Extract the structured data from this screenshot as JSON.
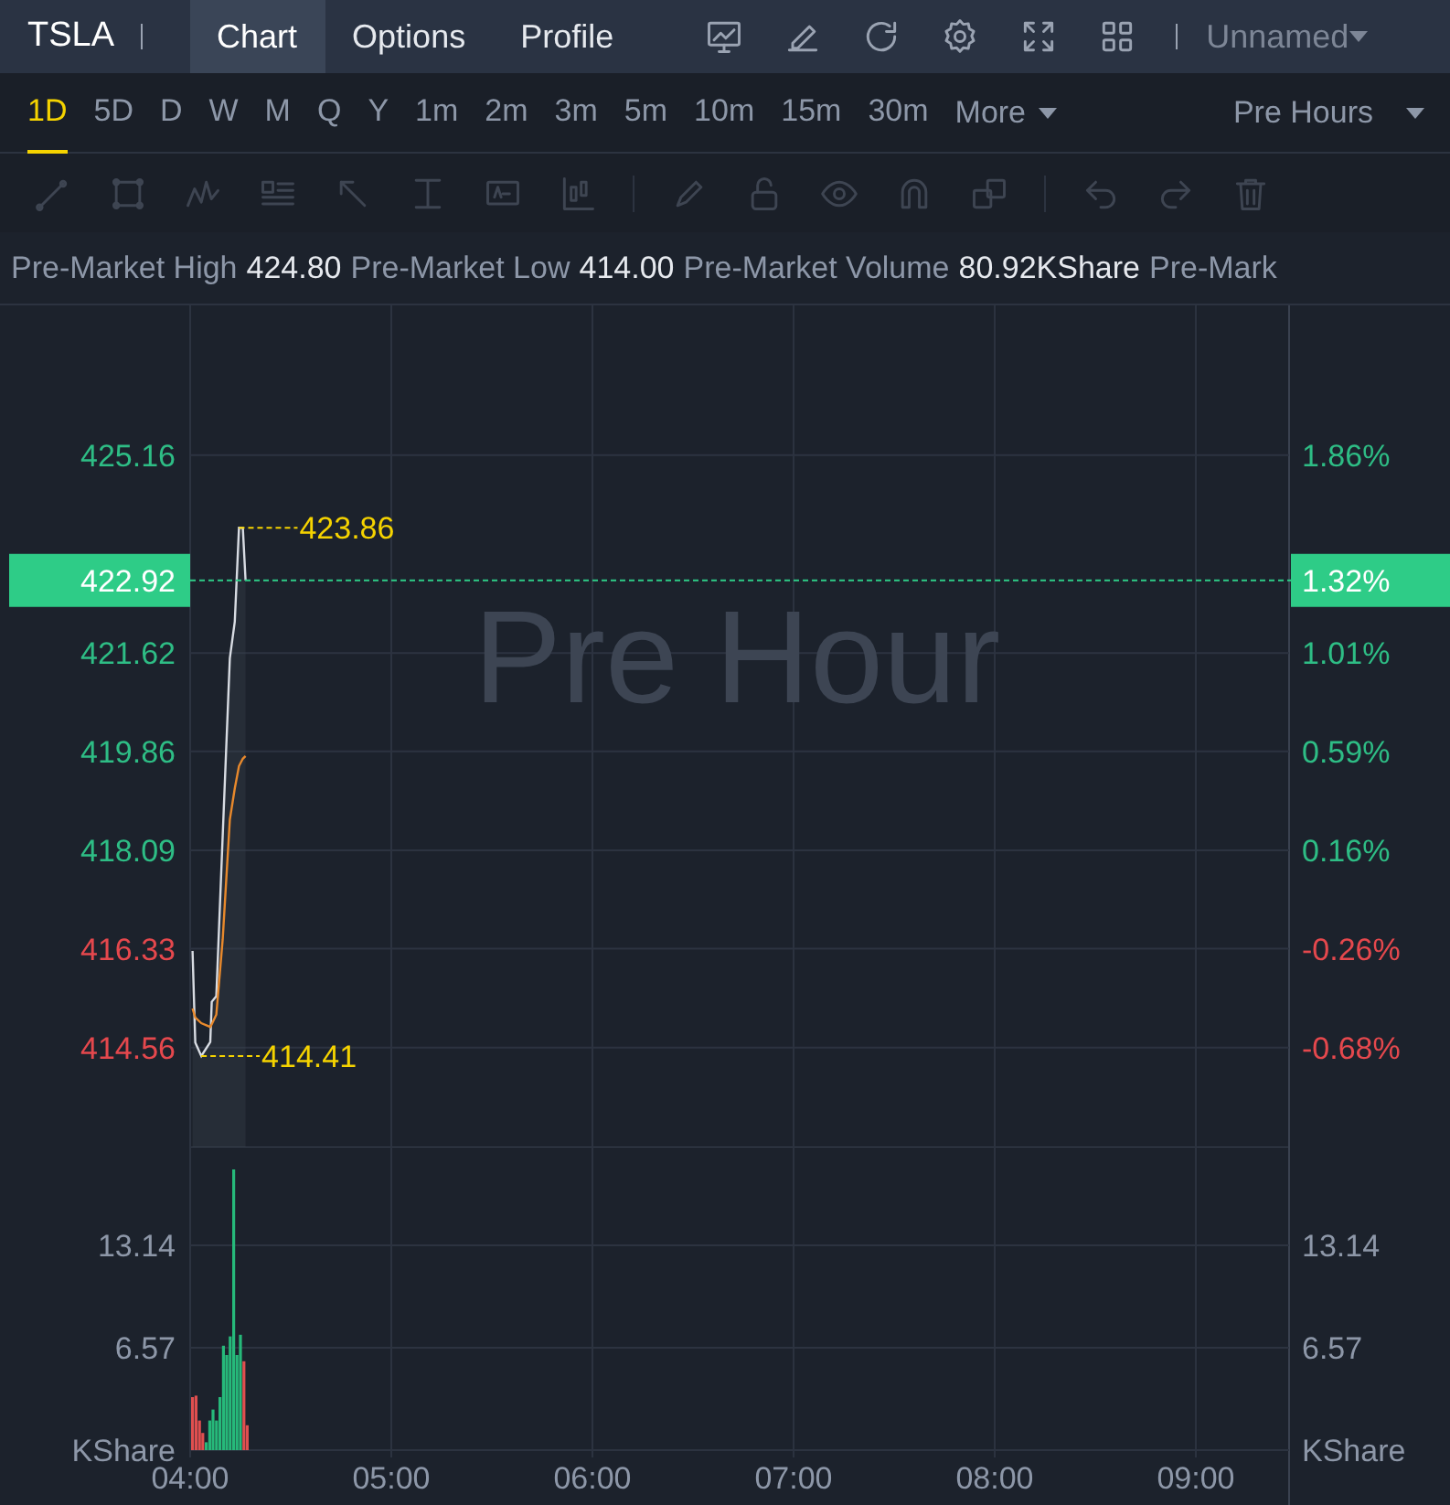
{
  "header": {
    "symbol": "TSLA",
    "tabs": [
      {
        "label": "Chart",
        "selected": true
      },
      {
        "label": "Options",
        "selected": false
      },
      {
        "label": "Profile",
        "selected": false
      }
    ],
    "layout_name": "Unnamed"
  },
  "timeframes": [
    {
      "label": "1D",
      "selected": true
    },
    {
      "label": "5D",
      "selected": false
    },
    {
      "label": "D",
      "selected": false
    },
    {
      "label": "W",
      "selected": false
    },
    {
      "label": "M",
      "selected": false
    },
    {
      "label": "Q",
      "selected": false
    },
    {
      "label": "Y",
      "selected": false
    },
    {
      "label": "1m",
      "selected": false
    },
    {
      "label": "2m",
      "selected": false
    },
    {
      "label": "3m",
      "selected": false
    },
    {
      "label": "5m",
      "selected": false
    },
    {
      "label": "10m",
      "selected": false
    },
    {
      "label": "15m",
      "selected": false
    },
    {
      "label": "30m",
      "selected": false
    }
  ],
  "more": "More",
  "session": "Pre Hours",
  "stats": [
    {
      "label": "Pre-Market High",
      "value": "424.80"
    },
    {
      "label": "Pre-Market Low",
      "value": "414.00"
    },
    {
      "label": "Pre-Market Volume",
      "value": "80.92KShare"
    },
    {
      "label": "Pre-Mark"
    }
  ],
  "watermark": "Pre Hour",
  "price_chart": {
    "chart_data": {
      "type": "line",
      "x": [
        4.012,
        4.025,
        4.055,
        4.1,
        4.107,
        4.13,
        4.162,
        4.197,
        4.222,
        4.243,
        4.262,
        4.275
      ],
      "series": [
        {
          "color": "#d8dce3",
          "values": [
            416.29,
            414.65,
            414.41,
            414.66,
            415.38,
            415.48,
            418.36,
            421.53,
            422.18,
            423.86,
            423.86,
            422.92
          ]
        },
        {
          "color": "#e8892c",
          "values": [
            415.26,
            415.1,
            415.0,
            414.93,
            414.98,
            415.15,
            416.5,
            418.64,
            419.2,
            419.6,
            419.73,
            419.78
          ]
        }
      ],
      "xlim": [
        4,
        9.4636
      ],
      "ylim": [
        412.79,
        427.84
      ],
      "yticks": [
        425.16,
        421.62,
        419.86,
        418.09,
        416.33,
        414.56
      ],
      "grid": true,
      "ref_lines": [
        {
          "axis": "y",
          "value": 422.92,
          "color": "#2ecc87"
        }
      ],
      "annotations": [
        {
          "x": 4.243,
          "y": 423.86,
          "text": "423.86"
        },
        {
          "x": 4.055,
          "y": 414.41,
          "text": "414.41"
        }
      ]
    },
    "percent_axis": [
      {
        "label": "1.86%",
        "color": "#2ebd85"
      },
      {
        "label": "1.01%",
        "color": "#2ebd85"
      },
      {
        "label": "0.59%",
        "color": "#2ebd85"
      },
      {
        "label": "0.16%",
        "color": "#2ebd85"
      },
      {
        "label": "-0.26%",
        "color": "#e5484d"
      },
      {
        "label": "-0.68%",
        "color": "#e5484d"
      }
    ],
    "last_price": {
      "price": "422.92",
      "change": "1.32%"
    }
  },
  "volume_chart": {
    "chart_data": {
      "type": "bar",
      "stacked": true,
      "grid": true,
      "ylabel": "KShare",
      "x": [
        4.012,
        4.029,
        4.046,
        4.063,
        4.08,
        4.097,
        4.114,
        4.131,
        4.148,
        4.165,
        4.182,
        4.199,
        4.216,
        4.233,
        4.25,
        4.267,
        4.284
      ],
      "series": [
        {
          "color": "#26b97a",
          "values": [
            null,
            null,
            null,
            null,
            0.5,
            1.9,
            2.6,
            1.9,
            3.4,
            6.7,
            6.1,
            7.3,
            18.0,
            6.1,
            7.4,
            null,
            null
          ]
        },
        {
          "color": "#e04f4f",
          "values": [
            3.4,
            3.5,
            1.9,
            1.1,
            null,
            null,
            null,
            null,
            null,
            null,
            null,
            null,
            null,
            null,
            null,
            5.7,
            1.6
          ]
        }
      ],
      "xlim": [
        4,
        9.4636
      ],
      "ylim": [
        0,
        19.47
      ],
      "yticks": [
        {
          "value": 13.14,
          "label": "13.14"
        },
        {
          "value": 6.57,
          "label": "6.57"
        }
      ],
      "xticks": [
        {
          "value": 4,
          "label": "04:00"
        },
        {
          "value": 5,
          "label": "05:00"
        },
        {
          "value": 6,
          "label": "06:00"
        },
        {
          "value": 7,
          "label": "07:00"
        },
        {
          "value": 8,
          "label": "08:00"
        },
        {
          "value": 9,
          "label": "09:00"
        }
      ]
    },
    "right_axis": [
      "13.14",
      "6.57",
      "KShare"
    ]
  }
}
